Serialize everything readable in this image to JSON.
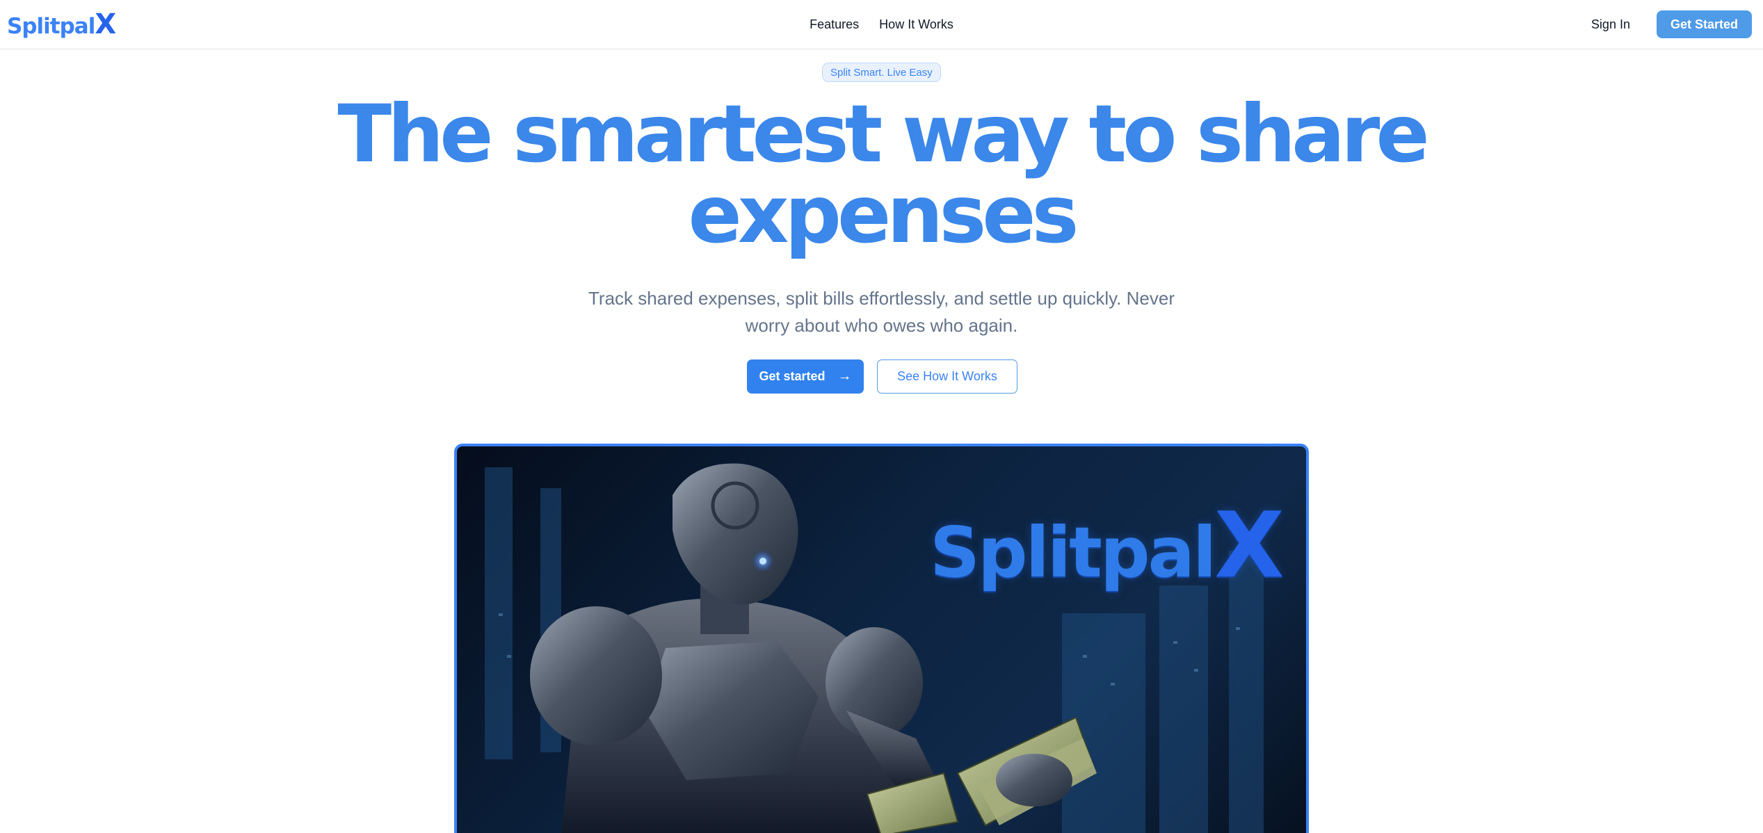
{
  "brand": {
    "name": "Splitpal",
    "name_suffix": "X"
  },
  "nav": {
    "items": [
      "Features",
      "How It Works"
    ]
  },
  "header": {
    "sign_in": "Sign In",
    "get_started": "Get Started"
  },
  "hero": {
    "badge": "Split Smart. Live Easy",
    "headline_line1": "The smartest way to share",
    "headline_line2": "expenses",
    "subtitle_line1": "Track shared expenses, split bills effortlessly, and settle up quickly. Never",
    "subtitle_line2": "worry about who owes who again.",
    "cta_primary": "Get started",
    "cta_secondary": "See How It Works",
    "image_logo": "Splitpal",
    "image_logo_suffix": "X"
  },
  "colors": {
    "accent": "#3b82f6",
    "accent_dark": "#2563eb",
    "text_muted": "#64748b",
    "image_bg": "#0c2340"
  }
}
